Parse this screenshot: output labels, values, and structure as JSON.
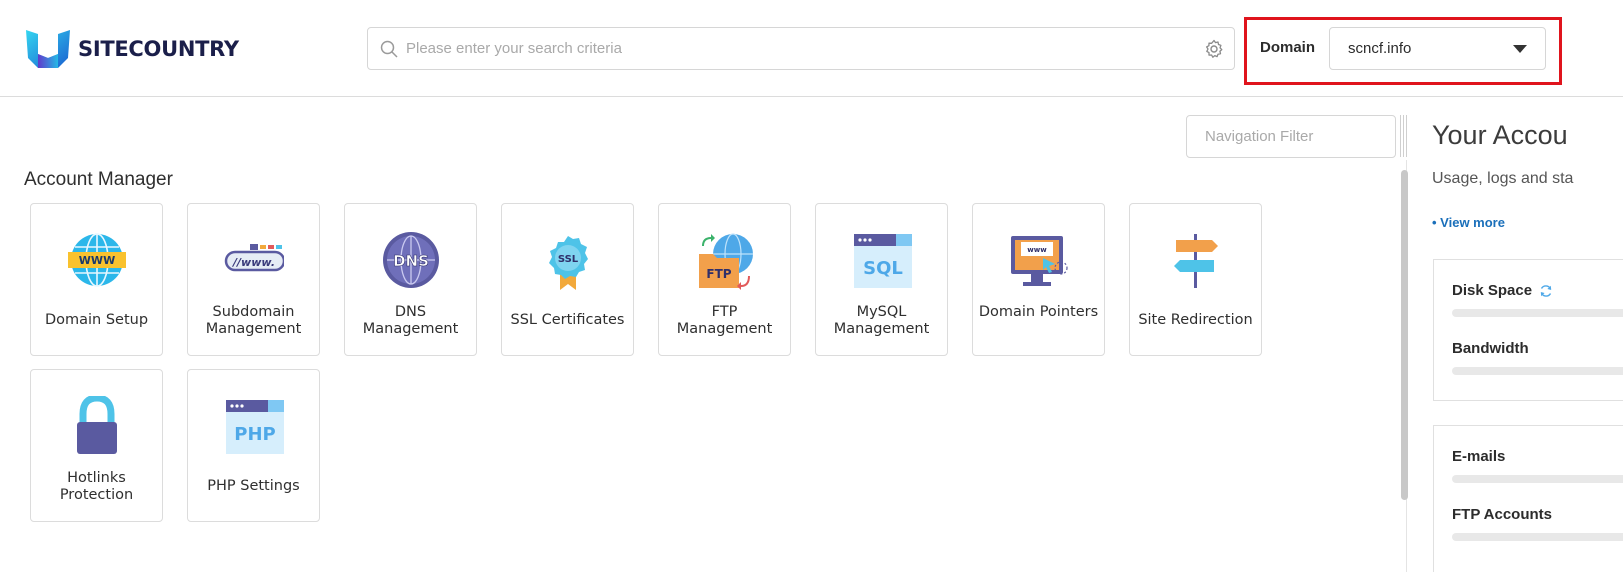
{
  "brand": {
    "name": "SITECOUNTRY",
    "colors": {
      "navy": "#1b1f4a",
      "cyan": "#27c4e8",
      "blue": "#1a6fba",
      "highlight": "#e0141d"
    }
  },
  "header": {
    "search": {
      "placeholder": "Please enter your search criteria",
      "value": ""
    },
    "domain": {
      "label": "Domain",
      "selected": "scncf.info"
    }
  },
  "navigation": {
    "filter_placeholder": "Navigation Filter"
  },
  "account_manager": {
    "title": "Account Manager",
    "items": [
      {
        "label": "Domain Setup",
        "icon": "globe-www-icon"
      },
      {
        "label": "Subdomain Management",
        "icon": "subdomain-www-icon"
      },
      {
        "label": "DNS Management",
        "icon": "dns-globe-icon"
      },
      {
        "label": "SSL Certificates",
        "icon": "ssl-badge-icon"
      },
      {
        "label": "FTP Management",
        "icon": "ftp-folder-icon"
      },
      {
        "label": "MySQL Management",
        "icon": "sql-window-icon"
      },
      {
        "label": "Domain Pointers",
        "icon": "monitor-pointer-icon"
      },
      {
        "label": "Site Redirection",
        "icon": "signpost-icon"
      },
      {
        "label": "Hotlinks Protection",
        "icon": "padlock-icon"
      },
      {
        "label": "PHP Settings",
        "icon": "php-window-icon"
      }
    ]
  },
  "account_panel": {
    "title": "Your Accou",
    "subtitle": "Usage, logs and sta",
    "view_more": "• View more",
    "stats_group_1": [
      {
        "label": "Disk Space"
      },
      {
        "label": "Bandwidth"
      }
    ],
    "stats_group_2": [
      {
        "label": "E-mails"
      },
      {
        "label": "FTP Accounts"
      }
    ]
  }
}
